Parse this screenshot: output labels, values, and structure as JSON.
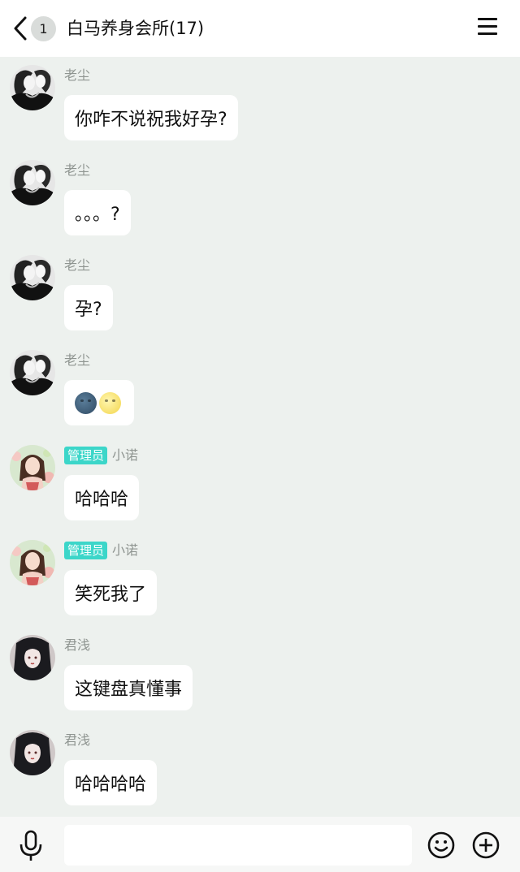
{
  "header": {
    "unread_count": "1",
    "title": "白马养身会所(17)"
  },
  "messages": [
    {
      "sender": "老尘",
      "text": "你咋不说祝我好孕?",
      "avatar": "manga-couple-avatar"
    },
    {
      "sender": "老尘",
      "text": "。。。?",
      "avatar": "manga-couple-avatar"
    },
    {
      "sender": "老尘",
      "text": "孕?",
      "avatar": "manga-couple-avatar"
    },
    {
      "sender": "老尘",
      "emojis": [
        "new-moon-face-emoji",
        "full-moon-face-emoji"
      ],
      "avatar": "manga-couple-avatar"
    },
    {
      "sender": "小诺",
      "badge": "管理员",
      "text": "哈哈哈",
      "avatar": "girl-with-flowers-avatar"
    },
    {
      "sender": "小诺",
      "badge": "管理员",
      "text": "笑死我了",
      "avatar": "girl-with-flowers-avatar"
    },
    {
      "sender": "君浅",
      "text": "这键盘真懂事",
      "avatar": "dark-hair-girl-avatar"
    },
    {
      "sender": "君浅",
      "text": "哈哈哈哈",
      "avatar": "dark-hair-girl-avatar"
    }
  ],
  "input": {
    "value": "",
    "icons": [
      "microphone-icon",
      "smiley-icon",
      "plus-circle-icon"
    ]
  },
  "colors": {
    "background": "#edf1ee",
    "badge": "#3cd6c9",
    "bubble": "#ffffff"
  }
}
